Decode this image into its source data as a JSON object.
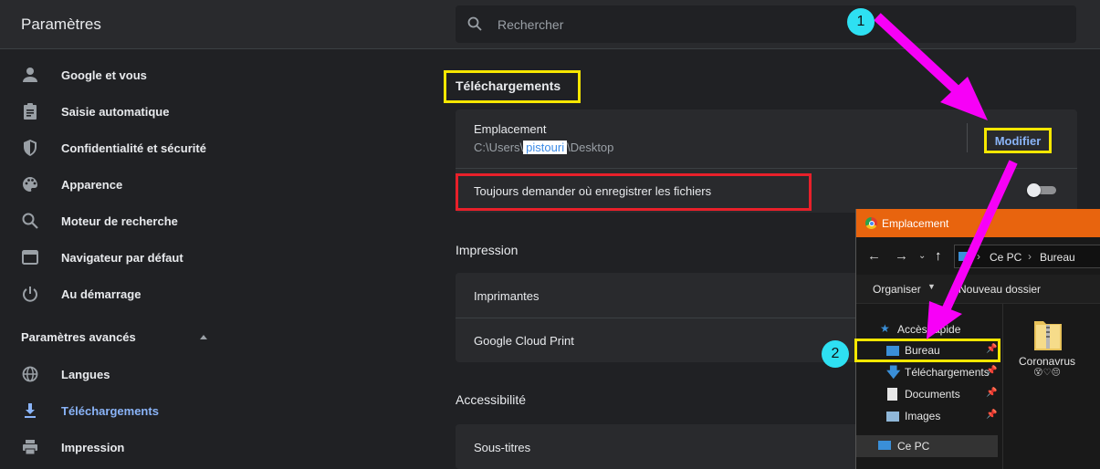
{
  "header": {
    "title": "Paramètres",
    "search_placeholder": "Rechercher"
  },
  "sidebar": {
    "items": [
      {
        "label": "Google et vous",
        "icon": "person-icon"
      },
      {
        "label": "Saisie automatique",
        "icon": "clipboard-icon"
      },
      {
        "label": "Confidentialité et sécurité",
        "icon": "shield-icon"
      },
      {
        "label": "Apparence",
        "icon": "palette-icon"
      },
      {
        "label": "Moteur de recherche",
        "icon": "search-icon"
      },
      {
        "label": "Navigateur par défaut",
        "icon": "browser-icon"
      },
      {
        "label": "Au démarrage",
        "icon": "power-icon"
      }
    ],
    "advanced_label": "Paramètres avancés",
    "advanced_items": [
      {
        "label": "Langues",
        "icon": "globe-icon"
      },
      {
        "label": "Téléchargements",
        "icon": "download-icon",
        "active": true
      },
      {
        "label": "Impression",
        "icon": "printer-icon"
      }
    ]
  },
  "downloads": {
    "section_title": "Téléchargements",
    "location_label": "Emplacement",
    "path_prefix": "C:\\Users\\",
    "path_user": "pistouri",
    "path_suffix": "\\Desktop",
    "modify_label": "Modifier",
    "ask_label": "Toujours demander où enregistrer les fichiers",
    "ask_enabled": false
  },
  "printing": {
    "section_title": "Impression",
    "items": [
      "Imprimantes",
      "Google Cloud Print"
    ]
  },
  "accessibility": {
    "section_title": "Accessibilité",
    "items": [
      "Sous-titres"
    ]
  },
  "annotations": {
    "badge_1": "1",
    "badge_2": "2",
    "arrow_color": "#f700f7",
    "highlight_yellow": "#f7e700",
    "highlight_red": "#e8202a"
  },
  "dialog": {
    "title": "Emplacement",
    "breadcrumb": [
      "Ce PC",
      "Bureau"
    ],
    "organize_label": "Organiser",
    "new_folder_label": "Nouveau dossier",
    "quick_access_label": "Accès rapide",
    "tree": [
      {
        "label": "Bureau",
        "icon": "desktop-folder-icon"
      },
      {
        "label": "Téléchargements",
        "icon": "download-folder-icon"
      },
      {
        "label": "Documents",
        "icon": "documents-folder-icon"
      },
      {
        "label": "Images",
        "icon": "images-folder-icon"
      }
    ],
    "this_pc_label": "Ce PC",
    "file_name": "Coronavrus",
    "file_sub": "😵♡😔"
  },
  "colors": {
    "bg": "#202124",
    "surface": "#292a2d",
    "accent": "#8ab4f8",
    "dialog_title": "#e8640e"
  }
}
